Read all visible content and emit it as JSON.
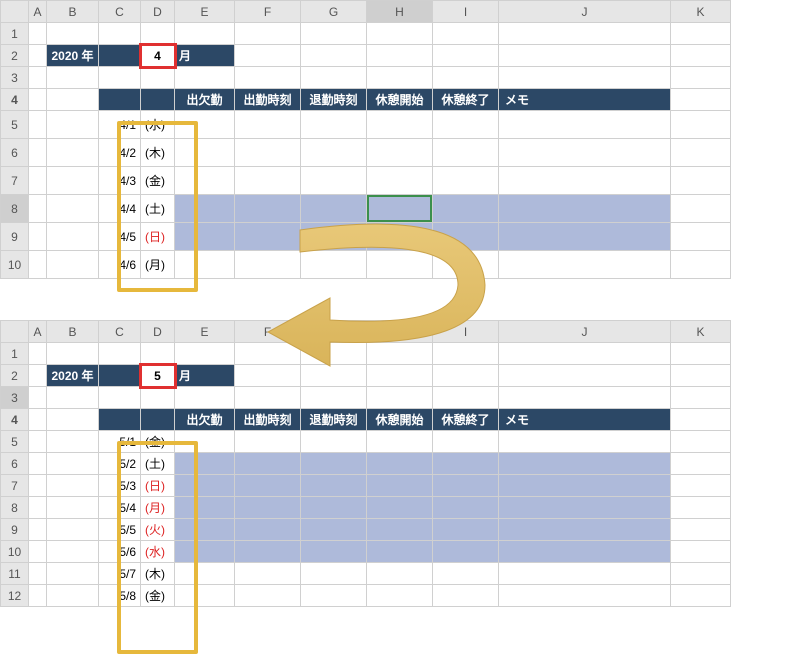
{
  "columns": [
    "A",
    "B",
    "C",
    "D",
    "E",
    "F",
    "G",
    "H",
    "I",
    "J",
    "K"
  ],
  "year_label": "2020 年",
  "month_suffix": "月",
  "table_headers": {
    "E": "出欠勤",
    "F": "出勤時刻",
    "G": "退勤時刻",
    "H": "休憩開始",
    "I": "休憩終了",
    "J": "メモ"
  },
  "top": {
    "month": "4",
    "rows": [
      {
        "n": 5,
        "date": "4/1",
        "dow": "(水)",
        "weekend": false,
        "red": false
      },
      {
        "n": 6,
        "date": "4/2",
        "dow": "(木)",
        "weekend": false,
        "red": false
      },
      {
        "n": 7,
        "date": "4/3",
        "dow": "(金)",
        "weekend": false,
        "red": false
      },
      {
        "n": 8,
        "date": "4/4",
        "dow": "(土)",
        "weekend": true,
        "red": false,
        "selected": true
      },
      {
        "n": 9,
        "date": "4/5",
        "dow": "(日)",
        "weekend": true,
        "red": true
      },
      {
        "n": 10,
        "date": "4/6",
        "dow": "(月)",
        "weekend": false,
        "red": false
      }
    ],
    "selected_col": "H",
    "selected_row": 8
  },
  "bottom": {
    "month": "5",
    "rows": [
      {
        "n": 5,
        "date": "5/1",
        "dow": "(金)",
        "weekend": false,
        "red": false
      },
      {
        "n": 6,
        "date": "5/2",
        "dow": "(土)",
        "weekend": true,
        "red": false
      },
      {
        "n": 7,
        "date": "5/3",
        "dow": "(日)",
        "weekend": true,
        "red": true
      },
      {
        "n": 8,
        "date": "5/4",
        "dow": "(月)",
        "weekend": true,
        "red": true
      },
      {
        "n": 9,
        "date": "5/5",
        "dow": "(火)",
        "weekend": true,
        "red": true
      },
      {
        "n": 10,
        "date": "5/6",
        "dow": "(水)",
        "weekend": true,
        "red": true
      },
      {
        "n": 11,
        "date": "5/7",
        "dow": "(木)",
        "weekend": false,
        "red": false
      },
      {
        "n": 12,
        "date": "5/8",
        "dow": "(金)",
        "weekend": false,
        "red": false
      }
    ],
    "selected_row": 3
  }
}
